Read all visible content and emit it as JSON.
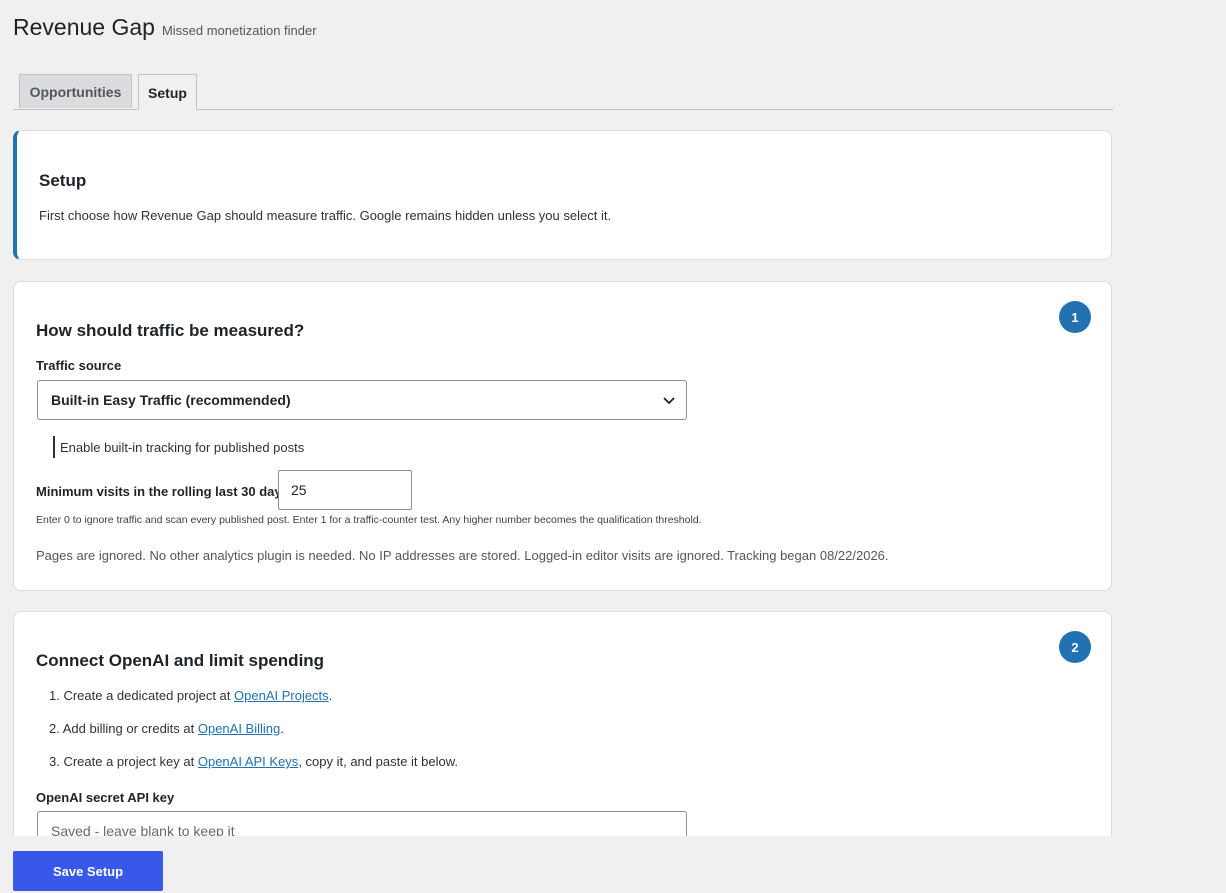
{
  "header": {
    "title": "Revenue Gap",
    "subtitle": "Missed monetization finder"
  },
  "tabs": [
    {
      "label": "Opportunities",
      "active": false
    },
    {
      "label": "Setup",
      "active": true
    }
  ],
  "intro": {
    "title": "Setup",
    "description": "First choose how Revenue Gap should measure traffic. Google remains hidden unless you select it."
  },
  "step1": {
    "badge": "1",
    "title": "How should traffic be measured?",
    "traffic_source_label": "Traffic source",
    "traffic_source_value": "Built-in Easy Traffic (recommended)",
    "tracking_label": "Enable built-in tracking for published posts",
    "min_visits_label": "Minimum visits in the rolling last 30 days",
    "min_visits_value": "25",
    "hint": "Enter 0 to ignore traffic and scan every published post. Enter 1 for a traffic-counter test. Any higher number becomes the qualification threshold.",
    "note": "Pages are ignored. No other analytics plugin is needed. No IP addresses are stored. Logged-in editor visits are ignored. Tracking began 08/22/2026."
  },
  "step2": {
    "badge": "2",
    "title": "Connect OpenAI and limit spending",
    "steps": [
      {
        "prefix": "1. Create a dedicated project at ",
        "link": "OpenAI Projects",
        "suffix": "."
      },
      {
        "prefix": "2. Add billing or credits at ",
        "link": "OpenAI Billing",
        "suffix": "."
      },
      {
        "prefix": "3. Create a project key at ",
        "link": "OpenAI API Keys",
        "suffix": ", copy it, and paste it below."
      }
    ],
    "api_key_label": "OpenAI secret API key",
    "api_key_placeholder": "Saved - leave blank to keep it"
  },
  "footer": {
    "save_label": "Save Setup"
  },
  "colors": {
    "accent": "#2271b1",
    "button": "#3858e9",
    "background": "#f0f0f1"
  }
}
